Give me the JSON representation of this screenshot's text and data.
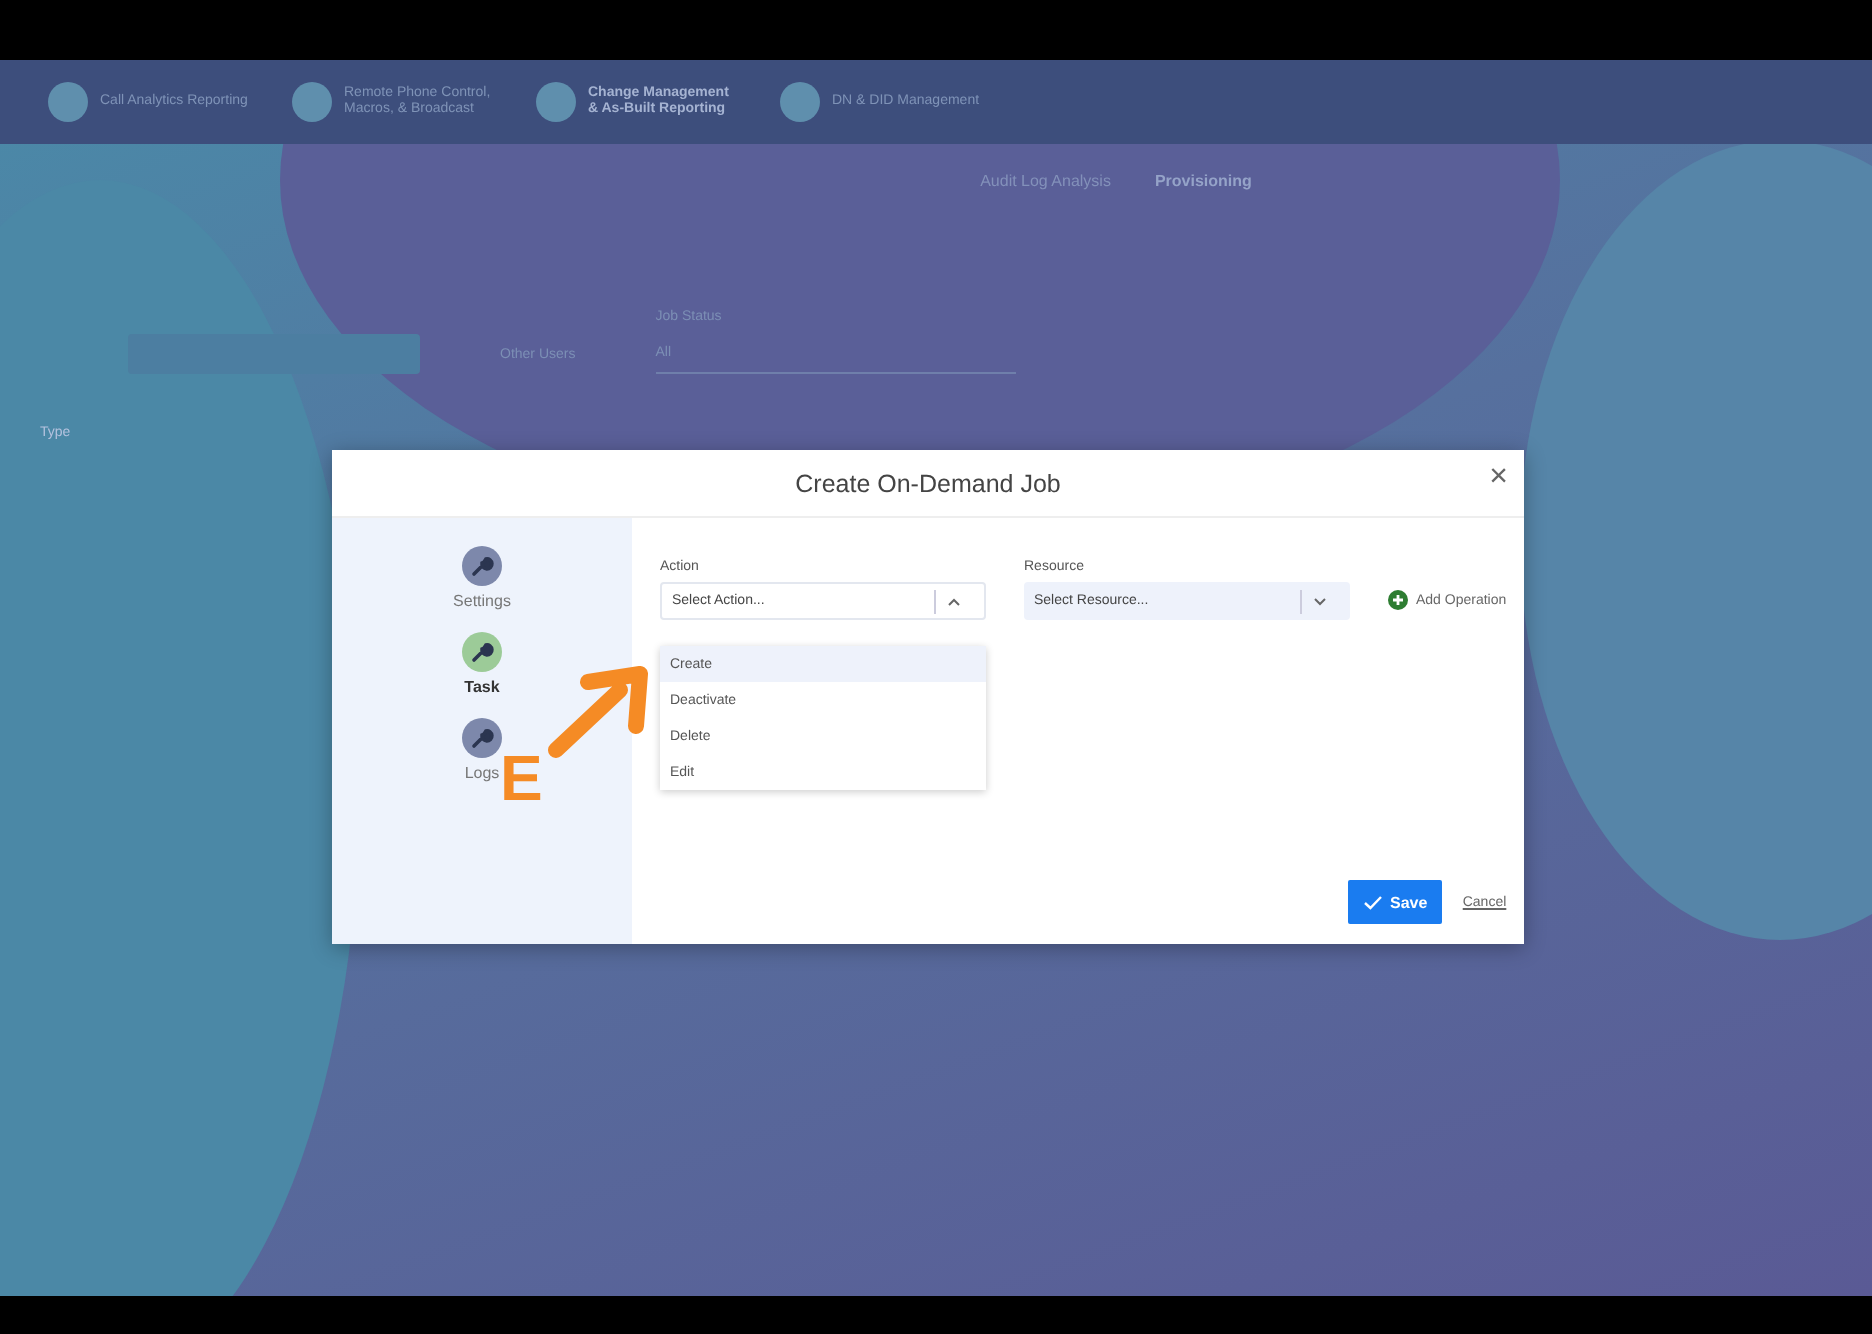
{
  "app": {
    "nav_items": [
      {
        "label": "Call Analytics Reporting",
        "selected": false
      },
      {
        "label": "Remote Phone Control, Macros, & Broadcast",
        "selected": false
      },
      {
        "label": "Change Management & As-Built Reporting",
        "selected": true
      },
      {
        "label": "DN & DID Management",
        "selected": false
      }
    ],
    "tabs": [
      {
        "label": "Audit Log Analysis",
        "selected": false
      },
      {
        "label": "Provisioning",
        "selected": true
      }
    ],
    "filters": {
      "job_status_label": "Job Status",
      "job_status_value": "All",
      "other_users": "Other Users"
    },
    "table": {
      "columns": [
        "Type"
      ]
    }
  },
  "dialog": {
    "title": "Create On-Demand Job",
    "close": "×",
    "steps": [
      {
        "label": "Settings",
        "selected": false,
        "color": "#7d88ab"
      },
      {
        "label": "Task",
        "selected": true,
        "color": "#9ccb98"
      },
      {
        "label": "Logs",
        "selected": false,
        "color": "#7d88ab"
      }
    ],
    "action": {
      "label": "Action",
      "placeholder": "Select Action...",
      "expanded": true,
      "options": [
        {
          "label": "Create",
          "selected": true
        },
        {
          "label": "Deactivate",
          "selected": false
        },
        {
          "label": "Delete",
          "selected": false
        },
        {
          "label": "Edit",
          "selected": false
        }
      ]
    },
    "resource": {
      "label": "Resource",
      "placeholder": "Select Resource...",
      "expanded": false
    },
    "add_operation": "Add Operation",
    "buttons": [
      {
        "kind": "primary",
        "label": "Save"
      },
      {
        "kind": "link",
        "label": "Cancel"
      }
    ]
  },
  "annotation": {
    "letter": "E"
  }
}
